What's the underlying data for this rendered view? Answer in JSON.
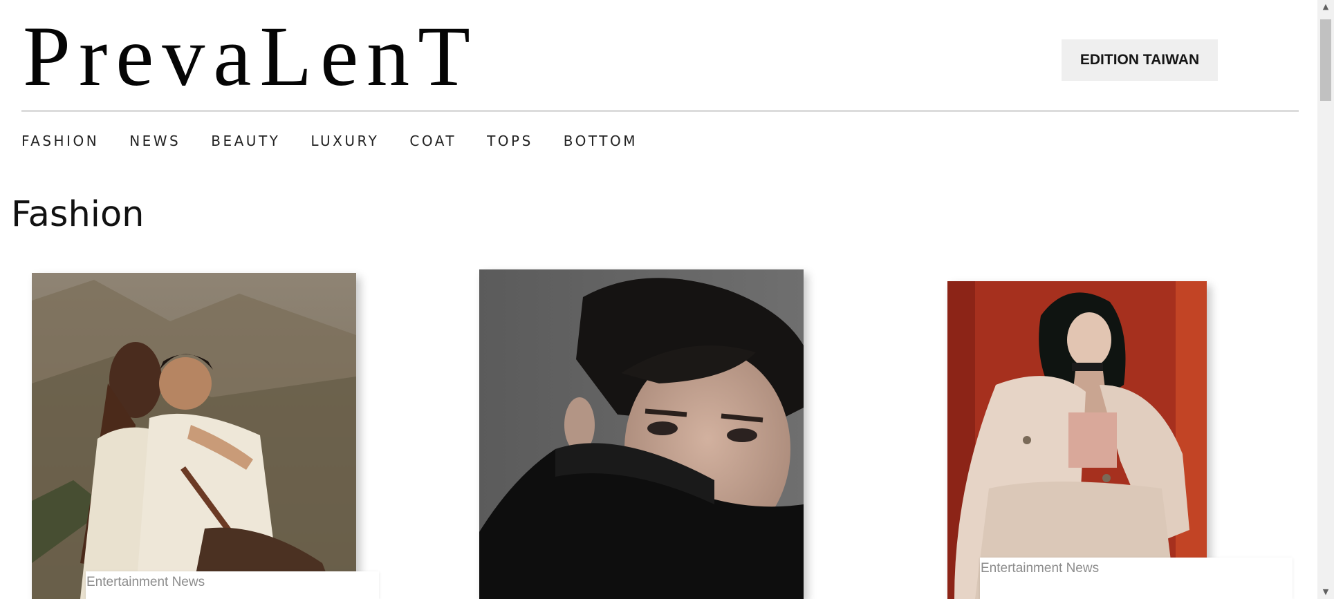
{
  "header": {
    "logo_text": "PrevaLenT",
    "edition_label": "EDITION TAIWAN"
  },
  "nav": {
    "items": [
      "FASHION",
      "NEWS",
      "BEAUTY",
      "LUXURY",
      "COAT",
      "TOPS",
      "BOTTOM"
    ]
  },
  "section": {
    "title": "Fashion"
  },
  "cards": [
    {
      "category": "Entertainment News"
    },
    {
      "category": ""
    },
    {
      "category": "Entertainment News"
    }
  ],
  "scrollbar": {
    "up_arrow": "▲",
    "down_arrow": "▼"
  },
  "colors": {
    "edition_bg": "#efefef",
    "rule": "#dcdcdc",
    "label_text": "#8c8c8c"
  }
}
